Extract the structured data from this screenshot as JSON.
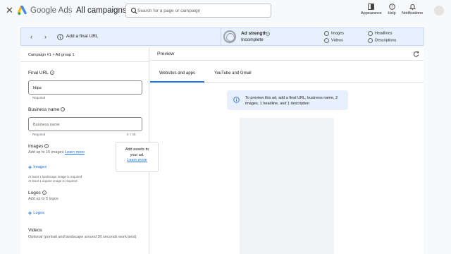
{
  "header": {
    "brand": "Google Ads",
    "page_title": "All campaigns",
    "search_placeholder": "Search for a page or campaign",
    "tools": [
      {
        "label": "Appearance",
        "icon": "appearance-icon"
      },
      {
        "label": "Help",
        "icon": "help-icon"
      },
      {
        "label": "Notifications",
        "icon": "bell-icon"
      }
    ]
  },
  "strip": {
    "final_url_prompt": "Add a final URL",
    "ad_strength_label": "Ad strength",
    "ad_strength_value": "Incomplete",
    "checklist": [
      "Images",
      "Videos",
      "Headlines",
      "Descriptions"
    ]
  },
  "form": {
    "breadcrumb": "Campaign #1 > Ad group 1",
    "final_url": {
      "label": "Final URL",
      "value": "https",
      "required": "Required"
    },
    "business_name": {
      "label": "Business name",
      "placeholder": "Business name",
      "required": "Required",
      "count": "0",
      "max": "/ 25"
    },
    "images": {
      "label": "Images",
      "desc": "Add up to 15 images",
      "learn_more": "Learn more",
      "button": "Images",
      "req1": "At least 1 landscape image is required",
      "req2": "At least 1 square image is required"
    },
    "logos": {
      "label": "Logos",
      "desc": "Add up to 5 logos",
      "button": "Logos"
    },
    "videos": {
      "label": "Videos",
      "desc": "Optional (portrait and landscape around 30 seconds work best)"
    }
  },
  "preview": {
    "title": "Preview",
    "tabs": [
      "Websites and apps",
      "YouTube and Gmail"
    ],
    "active_tab": 0,
    "notice": "To preview this ad, add a final URL, business name, 2 images, 1 headline, and 1 description",
    "empty_line1": "Add assets to",
    "empty_line2": "your ad.",
    "empty_link": "Learn more"
  },
  "colors": {
    "accent": "#1a73e8",
    "strip_bg": "#e8f0fe",
    "page_bg": "#f8f9fa"
  }
}
